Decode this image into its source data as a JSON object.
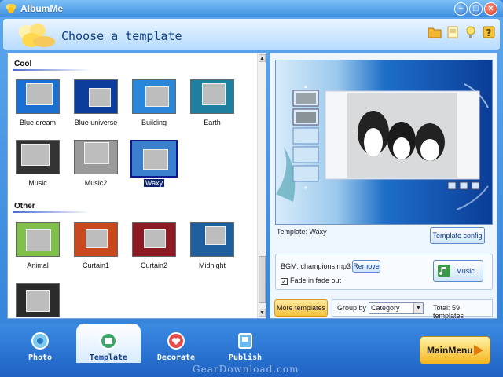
{
  "window": {
    "title": "AlbumMe"
  },
  "header": {
    "heading": "Choose a template"
  },
  "toolbar_icons": [
    "folder-icon",
    "note-icon",
    "light-bulb-icon",
    "help-icon"
  ],
  "sections": [
    {
      "title": "Cool",
      "templates": [
        {
          "name": "Blue dream",
          "color": "#1b6fd0"
        },
        {
          "name": "Blue universe",
          "color": "#0d3d9c"
        },
        {
          "name": "Building",
          "color": "#2a86d8"
        },
        {
          "name": "Earth",
          "color": "#1f7f9e"
        },
        {
          "name": "Music",
          "color": "#333333"
        },
        {
          "name": "Music2",
          "color": "#9a9a9a"
        },
        {
          "name": "Waxy",
          "color": "#3b7fcf",
          "selected": true
        }
      ]
    },
    {
      "title": "Other",
      "templates": [
        {
          "name": "Animal",
          "color": "#7fbf4a"
        },
        {
          "name": "Curtain1",
          "color": "#c9481d"
        },
        {
          "name": "Curtain2",
          "color": "#8c1a22"
        },
        {
          "name": "Midnight",
          "color": "#1f5f9e"
        },
        {
          "name": "",
          "color": "#2b2b2b"
        }
      ]
    }
  ],
  "preview": {
    "template_label": "Template:  Waxy",
    "template_config_label": "Template config",
    "bgm_label": "BGM:  champions.mp3",
    "remove_label": "Remove",
    "fade_label": "Fade in fade out",
    "fade_checked": true,
    "music_label": "Music"
  },
  "footer": {
    "more_templates_label": "More templates",
    "group_by_label": "Group by",
    "group_by_value": "Category",
    "total_label": "Total: 59 templates"
  },
  "nav": {
    "items": [
      {
        "label": "Photo"
      },
      {
        "label": "Template",
        "active": true
      },
      {
        "label": "Decorate"
      },
      {
        "label": "Publish"
      }
    ],
    "main_menu_label": "MainMenu"
  },
  "watermark": "GearDownload.com"
}
